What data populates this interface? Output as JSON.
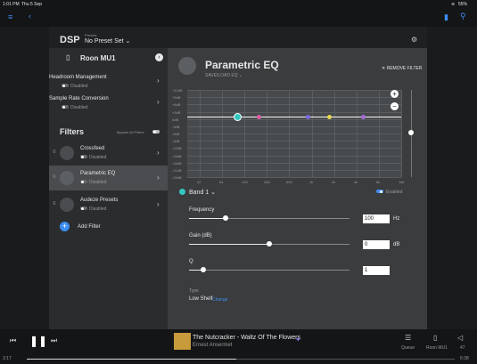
{
  "status_bar": {
    "time": "1:01 PM",
    "date": "Thu 5 Sep",
    "battery": "55%"
  },
  "header": {
    "title": "DSP",
    "presets_label": "Presets",
    "preset_value": "No Preset Set"
  },
  "device": {
    "name": "Roon MU1"
  },
  "left_panel": {
    "headroom": {
      "title": "Headroom Management",
      "status": "Disabled"
    },
    "sample_rate": {
      "title": "Sample Rate Conversion",
      "status": "Disabled"
    },
    "filters_title": "Filters",
    "bypass_label": "Bypass All Filters",
    "filters": [
      {
        "name": "Crossfeed",
        "status": "Disabled"
      },
      {
        "name": "Parametric EQ",
        "status": "Disabled"
      },
      {
        "name": "Audeze Presets",
        "status": "Disabled"
      }
    ],
    "add_filter": "Add Filter"
  },
  "eq": {
    "title": "Parametric EQ",
    "save_load": "SAVE/LOAD EQ",
    "remove_filter": "REMOVE FILTER",
    "db_labels": [
      "+12dB",
      "+9dB",
      "+6dB",
      "+3dB",
      "0dB",
      "-3dB",
      "-6dB",
      "-9dB",
      "-12dB",
      "-15dB",
      "-18dB",
      "-21dB",
      "-24dB"
    ],
    "freq_labels": [
      "32",
      "64",
      "125",
      "250",
      "500",
      "1k",
      "2k",
      "4k",
      "8k",
      "16k"
    ],
    "band_label": "Band 1",
    "band_enabled": "Enabled",
    "frequency_label": "Frequency",
    "frequency_value": "100",
    "frequency_unit": "Hz",
    "gain_label": "Gain (dB)",
    "gain_value": "0",
    "gain_unit": "dB",
    "q_label": "Q",
    "q_value": "1",
    "type_label": "Type",
    "type_value": "Low Shelf",
    "type_change": "Change",
    "band_colors": [
      "#35c6c0",
      "#e05aa8",
      "#7a6be0",
      "#e6d84a",
      "#a66be0"
    ],
    "frequency_slider": 0.23,
    "gain_slider": 0.5,
    "q_slider": 0.09
  },
  "player": {
    "time_elapsed": "3:17",
    "time_total": "6:38",
    "track_title": "The Nutcracker - Waltz Of The Flowers",
    "artist": "Ernest Ansermet",
    "queue_label": "Queue",
    "zone_label": "Roon MU1",
    "volume": "47",
    "progress": 0.49
  }
}
